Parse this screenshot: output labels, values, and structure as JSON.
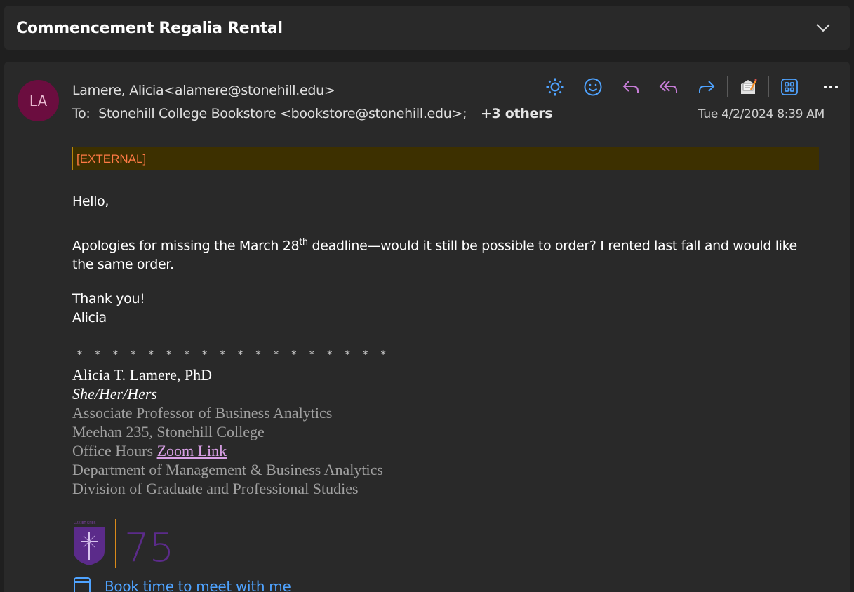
{
  "subject": "Commencement Regalia Rental",
  "message": {
    "avatar_initials": "LA",
    "sender": "Lamere, Alicia<alamere@stonehill.edu>",
    "to_label": "To:",
    "to_value": "Stonehill College Bookstore <bookstore@stonehill.edu>;",
    "others": "+3 others",
    "timestamp": "Tue 4/2/2024 8:39 AM",
    "external_tag": "[EXTERNAL]",
    "greeting": "Hello,",
    "body_part1": "Apologies for missing the March 28",
    "body_sup": "th",
    "body_part2": " deadline—would it still be possible to order? I rented last fall and would like",
    "body_line2": "the same order.",
    "thanks": "Thank you!",
    "signoff": "Alicia"
  },
  "signature": {
    "stars": "* * * * * * * * * * * * * * * * * *",
    "name": "Alicia T. Lamere, PhD",
    "pronouns": "She/Her/Hers",
    "title": "Associate Professor of Business Analytics",
    "office": "Meehan 235, Stonehill College",
    "hours_label": "Office Hours ",
    "hours_link": "Zoom Link",
    "department": "Department of Management & Business Analytics",
    "division": "Division of Graduate and Professional Studies",
    "logo_number": "75",
    "meet_link": "Book time to meet with me"
  },
  "toolbar_icons": [
    "sun-icon",
    "emoji-icon",
    "reply-icon",
    "reply-all-icon",
    "forward-icon",
    "signature-icon",
    "apps-icon",
    "more-icon"
  ],
  "colors": {
    "accent_blue": "#4fa3ff",
    "reply_purple": "#c77dd8",
    "external_text": "#ff7a45",
    "avatar_bg": "#6b0d3f"
  }
}
